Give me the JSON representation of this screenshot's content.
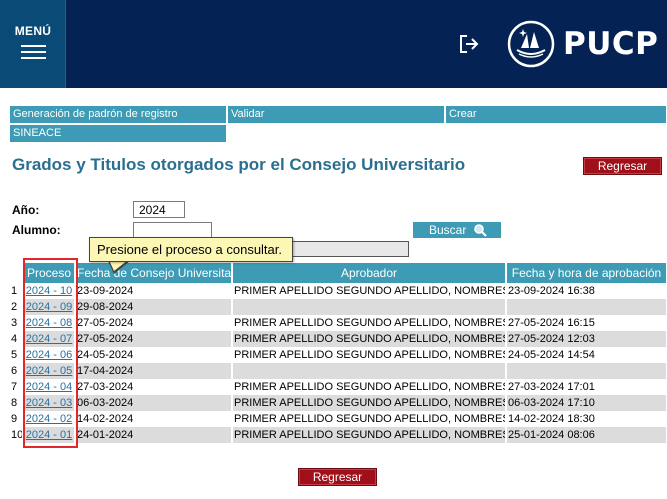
{
  "header": {
    "menu_label": "MENÚ",
    "logo_text": "PUCP",
    "colors": {
      "header_bg": "#042354",
      "menu_bg": "#0a4a76"
    }
  },
  "nav": {
    "row1": [
      "Generación de padrón de registro",
      "Validar",
      "Crear"
    ],
    "row2": [
      "SINEACE"
    ]
  },
  "page_title": "Grados y Titulos otorgados por el Consejo Universitario",
  "buttons": {
    "regresar_top": "Regresar",
    "regresar_bottom": "Regresar",
    "buscar": "Buscar"
  },
  "form": {
    "anio_label": "Año:",
    "anio_value": "2024",
    "alumno_label": "Alumno:",
    "alumno_value": "",
    "alumno2_value": ""
  },
  "tooltip": "Presione el proceso a consultar.",
  "table": {
    "headers": [
      "",
      "Proceso",
      "Fecha de Consejo Universitario",
      "Aprobador",
      "Fecha y hora de aprobación"
    ],
    "rows": [
      {
        "num": "1",
        "proceso": "2024 - 10",
        "fecha": "23-09-2024",
        "aprobador": "PRIMER APELLIDO SEGUNDO APELLIDO, NOMBRES",
        "fecha_aprob": "23-09-2024 16:38"
      },
      {
        "num": "2",
        "proceso": "2024 - 09",
        "fecha": "29-08-2024",
        "aprobador": "",
        "fecha_aprob": ""
      },
      {
        "num": "3",
        "proceso": "2024 - 08",
        "fecha": "27-05-2024",
        "aprobador": "PRIMER APELLIDO SEGUNDO APELLIDO, NOMBRES",
        "fecha_aprob": "27-05-2024 16:15"
      },
      {
        "num": "4",
        "proceso": "2024 - 07",
        "fecha": "27-05-2024",
        "aprobador": "PRIMER APELLIDO SEGUNDO APELLIDO, NOMBRES",
        "fecha_aprob": "27-05-2024 12:03"
      },
      {
        "num": "5",
        "proceso": "2024 - 06",
        "fecha": "24-05-2024",
        "aprobador": "PRIMER APELLIDO SEGUNDO APELLIDO, NOMBRES",
        "fecha_aprob": "24-05-2024 14:54"
      },
      {
        "num": "6",
        "proceso": "2024 - 05",
        "fecha": "17-04-2024",
        "aprobador": "",
        "fecha_aprob": ""
      },
      {
        "num": "7",
        "proceso": "2024 - 04",
        "fecha": "27-03-2024",
        "aprobador": "PRIMER APELLIDO SEGUNDO APELLIDO, NOMBRES",
        "fecha_aprob": "27-03-2024 17:01"
      },
      {
        "num": "8",
        "proceso": "2024 - 03",
        "fecha": "06-03-2024",
        "aprobador": "PRIMER APELLIDO SEGUNDO APELLIDO, NOMBRES",
        "fecha_aprob": "06-03-2024 17:10"
      },
      {
        "num": "9",
        "proceso": "2024 - 02",
        "fecha": "14-02-2024",
        "aprobador": "PRIMER APELLIDO SEGUNDO APELLIDO, NOMBRES",
        "fecha_aprob": "14-02-2024 18:30"
      },
      {
        "num": "10",
        "proceso": "2024 - 01",
        "fecha": "24-01-2024",
        "aprobador": "PRIMER APELLIDO SEGUNDO APELLIDO, NOMBRES",
        "fecha_aprob": "25-01-2024 08:06"
      }
    ]
  }
}
